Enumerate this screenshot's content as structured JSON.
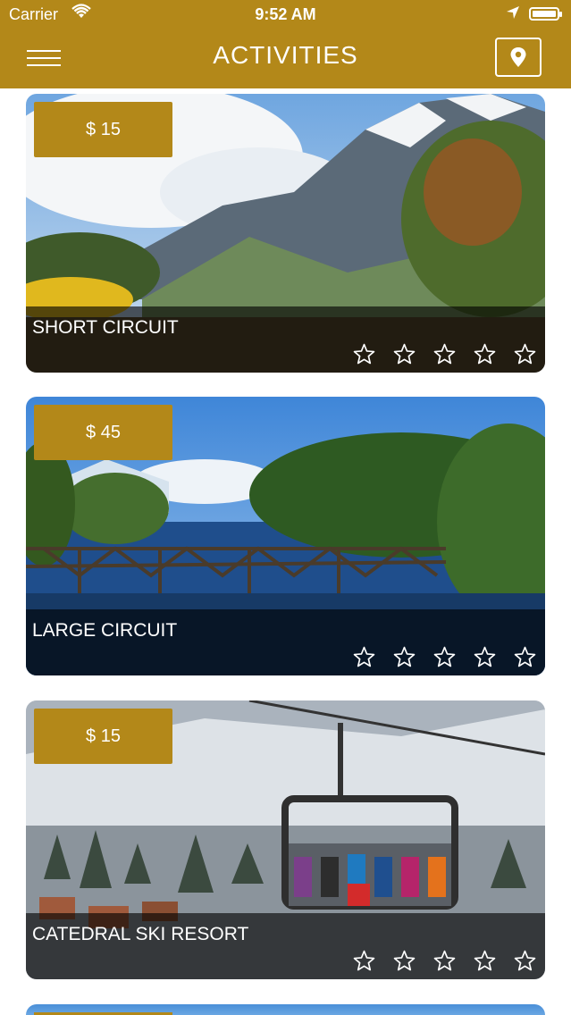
{
  "status_bar": {
    "carrier": "Carrier",
    "time": "9:52 AM"
  },
  "nav": {
    "title": "ACTIVITIES",
    "menu_icon": "hamburger-menu-icon",
    "map_icon": "map-pin-icon"
  },
  "colors": {
    "accent": "#b38819",
    "overlay": "#000000"
  },
  "activities": [
    {
      "price": "$ 15",
      "name": "SHORT CIRCUIT",
      "rating": 0,
      "max_rating": 5
    },
    {
      "price": "$ 45",
      "name": "LARGE CIRCUIT",
      "rating": 0,
      "max_rating": 5
    },
    {
      "price": "$ 15",
      "name": "CATEDRAL SKI RESORT",
      "rating": 0,
      "max_rating": 5
    }
  ]
}
